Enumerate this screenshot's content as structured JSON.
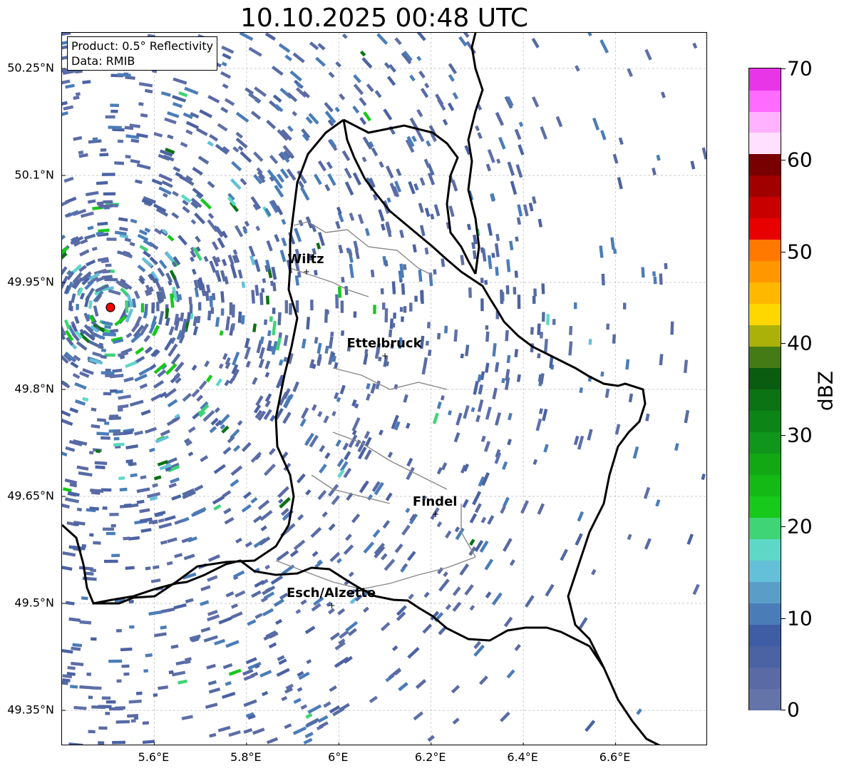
{
  "title": "10.10.2025 00:48 UTC",
  "info": {
    "product": "Product: 0.5° Reflectivity",
    "data": "Data: RMIB"
  },
  "axes": {
    "lat_ticks": [
      "50.25°N",
      "50.1°N",
      "49.95°N",
      "49.8°N",
      "49.65°N",
      "49.5°N",
      "49.35°N"
    ],
    "lon_ticks": [
      "5.6°E",
      "5.8°E",
      "6°E",
      "6.2°E",
      "6.4°E",
      "6.6°E"
    ],
    "lat_values": [
      50.25,
      50.1,
      49.95,
      49.8,
      49.65,
      49.5,
      49.35
    ],
    "lon_values": [
      5.6,
      5.8,
      6.0,
      6.2,
      6.4,
      6.6
    ],
    "lon_range": [
      5.4,
      6.8
    ],
    "lat_range": [
      49.3,
      50.3
    ]
  },
  "radar_site": {
    "lon": 5.505,
    "lat": 49.915,
    "color": "#ff0000"
  },
  "cities": [
    {
      "name": "Wiltz",
      "lon": 5.93,
      "lat": 49.965
    },
    {
      "name": "Ettelbruck",
      "lon": 6.1,
      "lat": 49.847
    },
    {
      "name": "Findel",
      "lon": 6.21,
      "lat": 49.625
    },
    {
      "name": "Esch/Alzette",
      "lon": 5.985,
      "lat": 49.497
    }
  ],
  "colorbar": {
    "label": "dBZ",
    "ticks": [
      "0",
      "10",
      "20",
      "30",
      "40",
      "50",
      "60",
      "70"
    ],
    "colors": [
      "#6473a8",
      "#5a6aa5",
      "#4b62a3",
      "#3f5da5",
      "#4a7db8",
      "#5a9ec8",
      "#64c0d8",
      "#5ed8c6",
      "#3fd476",
      "#16c91a",
      "#14b916",
      "#12a814",
      "#10961a",
      "#0c8516",
      "#0b7314",
      "#0a5c10",
      "#457b14",
      "#acb10a",
      "#ffd700",
      "#ffb800",
      "#ff9800",
      "#ff7800",
      "#e80000",
      "#c80000",
      "#a00000",
      "#780000",
      "#ffe0ff",
      "#ffb2ff",
      "#ff6aff",
      "#e835e8"
    ]
  }
}
